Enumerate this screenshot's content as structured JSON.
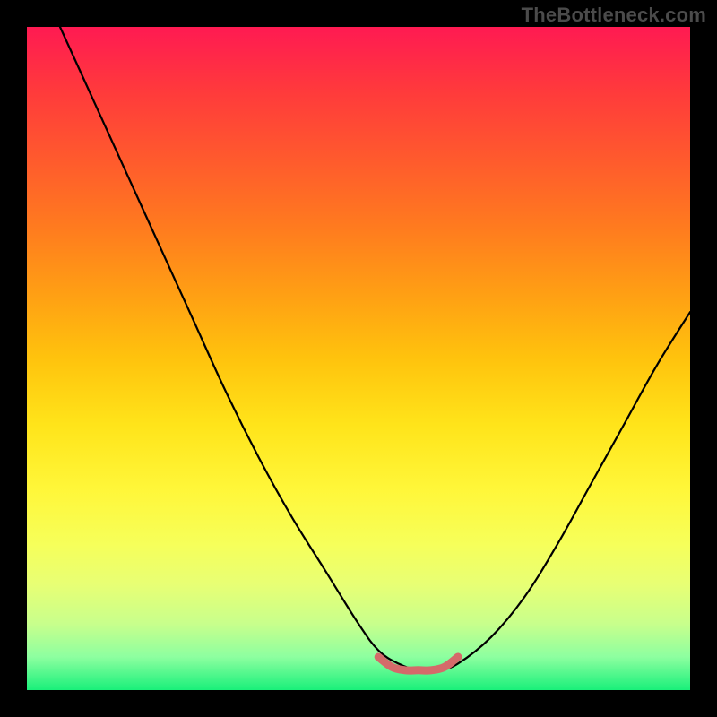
{
  "watermark": "TheBottleneck.com",
  "chart_data": {
    "type": "line",
    "title": "",
    "xlabel": "",
    "ylabel": "",
    "xlim": [
      0,
      100
    ],
    "ylim": [
      0,
      100
    ],
    "background_gradient": {
      "top": "#ff1a52",
      "upper_mid": "#ff9e14",
      "mid": "#ffe41a",
      "lower_mid": "#e8ff74",
      "bottom": "#19f07a"
    },
    "series": [
      {
        "name": "main-curve",
        "color": "#000000",
        "x": [
          5,
          10,
          15,
          20,
          25,
          30,
          35,
          40,
          45,
          50,
          53,
          56,
          59,
          62,
          65,
          70,
          75,
          80,
          85,
          90,
          95,
          100
        ],
        "y": [
          100,
          89,
          78,
          67,
          56,
          45,
          35,
          26,
          18,
          10,
          6,
          4,
          3,
          3,
          4,
          8,
          14,
          22,
          31,
          40,
          49,
          57
        ]
      },
      {
        "name": "bottom-marker-band",
        "color": "#d96a6a",
        "x": [
          53,
          55,
          57,
          59,
          61,
          63,
          65
        ],
        "y": [
          5,
          3.5,
          3,
          3,
          3,
          3.5,
          5
        ]
      }
    ],
    "optimal_range": {
      "x_start": 53,
      "x_end": 65
    }
  }
}
